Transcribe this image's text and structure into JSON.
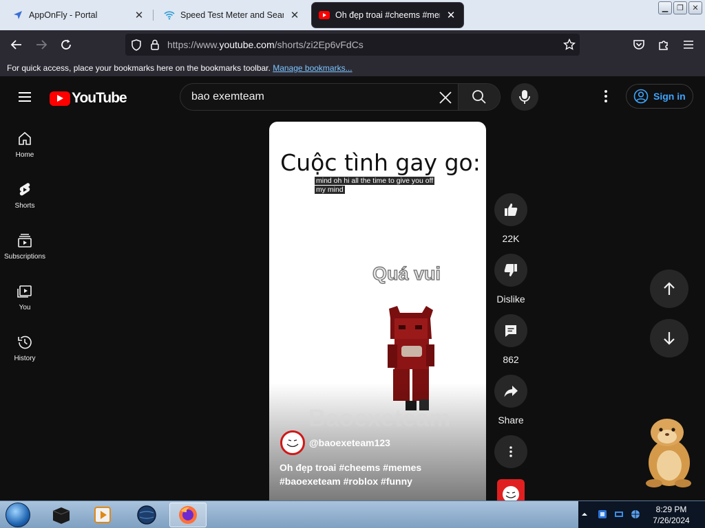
{
  "browser": {
    "tabs": [
      {
        "title": "AppOnFly - Portal",
        "icon": "send-arrow-icon",
        "active": false
      },
      {
        "title": "Speed Test Meter and Search",
        "icon": "wifi-icon",
        "active": false
      },
      {
        "title": "Oh đẹp troai #cheems #memes",
        "icon": "youtube-icon",
        "active": true
      }
    ],
    "url_prefix": "https://www.",
    "url_domain": "youtube.com",
    "url_path": "/shorts/zi2Ep6vFdCs",
    "bookmarks_message": "For quick access, place your bookmarks here on the bookmarks toolbar.",
    "bookmarks_link": "Manage bookmarks..."
  },
  "youtube": {
    "logo_text": "YouTube",
    "search_value": "bao exemteam",
    "sign_in_label": "Sign in",
    "sidebar": [
      {
        "label": "Home",
        "icon": "home-icon"
      },
      {
        "label": "Shorts",
        "icon": "shorts-icon"
      },
      {
        "label": "Subscriptions",
        "icon": "subscriptions-icon"
      },
      {
        "label": "You",
        "icon": "you-icon"
      },
      {
        "label": "History",
        "icon": "history-icon"
      }
    ],
    "short": {
      "title_overlay": "Cuộc tình gay go:",
      "caption_line1": "mind oh hi all the time to give you off",
      "caption_line2": "my mind",
      "sticker_text": "Quá vui",
      "watermark": "Baoexeteam",
      "channel": "@baoexeteam123",
      "description_line1": "Oh đẹp troai #cheems #memes",
      "description_line2": "#baoexeteam #roblox #funny"
    },
    "actions": {
      "like_count": "22K",
      "dislike_label": "Dislike",
      "comment_count": "862",
      "share_label": "Share"
    },
    "colors": {
      "brand_red": "#ff0000",
      "link_blue": "#3ea6ff"
    }
  },
  "taskbar": {
    "time": "8:29 PM",
    "date": "7/26/2024"
  }
}
